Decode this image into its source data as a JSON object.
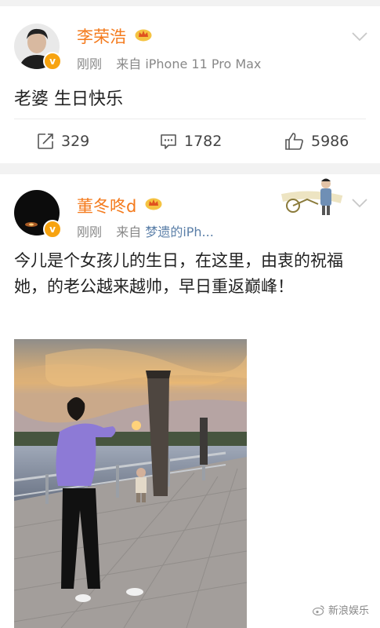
{
  "post1": {
    "username": "李荣浩",
    "time": "刚刚",
    "source_prefix": "来自",
    "source": "iPhone 11 Pro Max",
    "text": "老婆 生日快乐",
    "repost_count": "329",
    "comment_count": "1782",
    "like_count": "5986"
  },
  "post2": {
    "username": "董冬咚d",
    "time": "刚刚",
    "source_prefix": "来自",
    "source": "梦遗的iPh...",
    "text": "今儿是个女孩儿的生日，在这里，由衷的祝福她，的老公越来越帅，早日重返巅峰！"
  },
  "watermark": "新浪娱乐",
  "colors": {
    "username": "#f47a1c",
    "verified_badge": "#f7a310",
    "source_link": "#5b7fa8"
  }
}
